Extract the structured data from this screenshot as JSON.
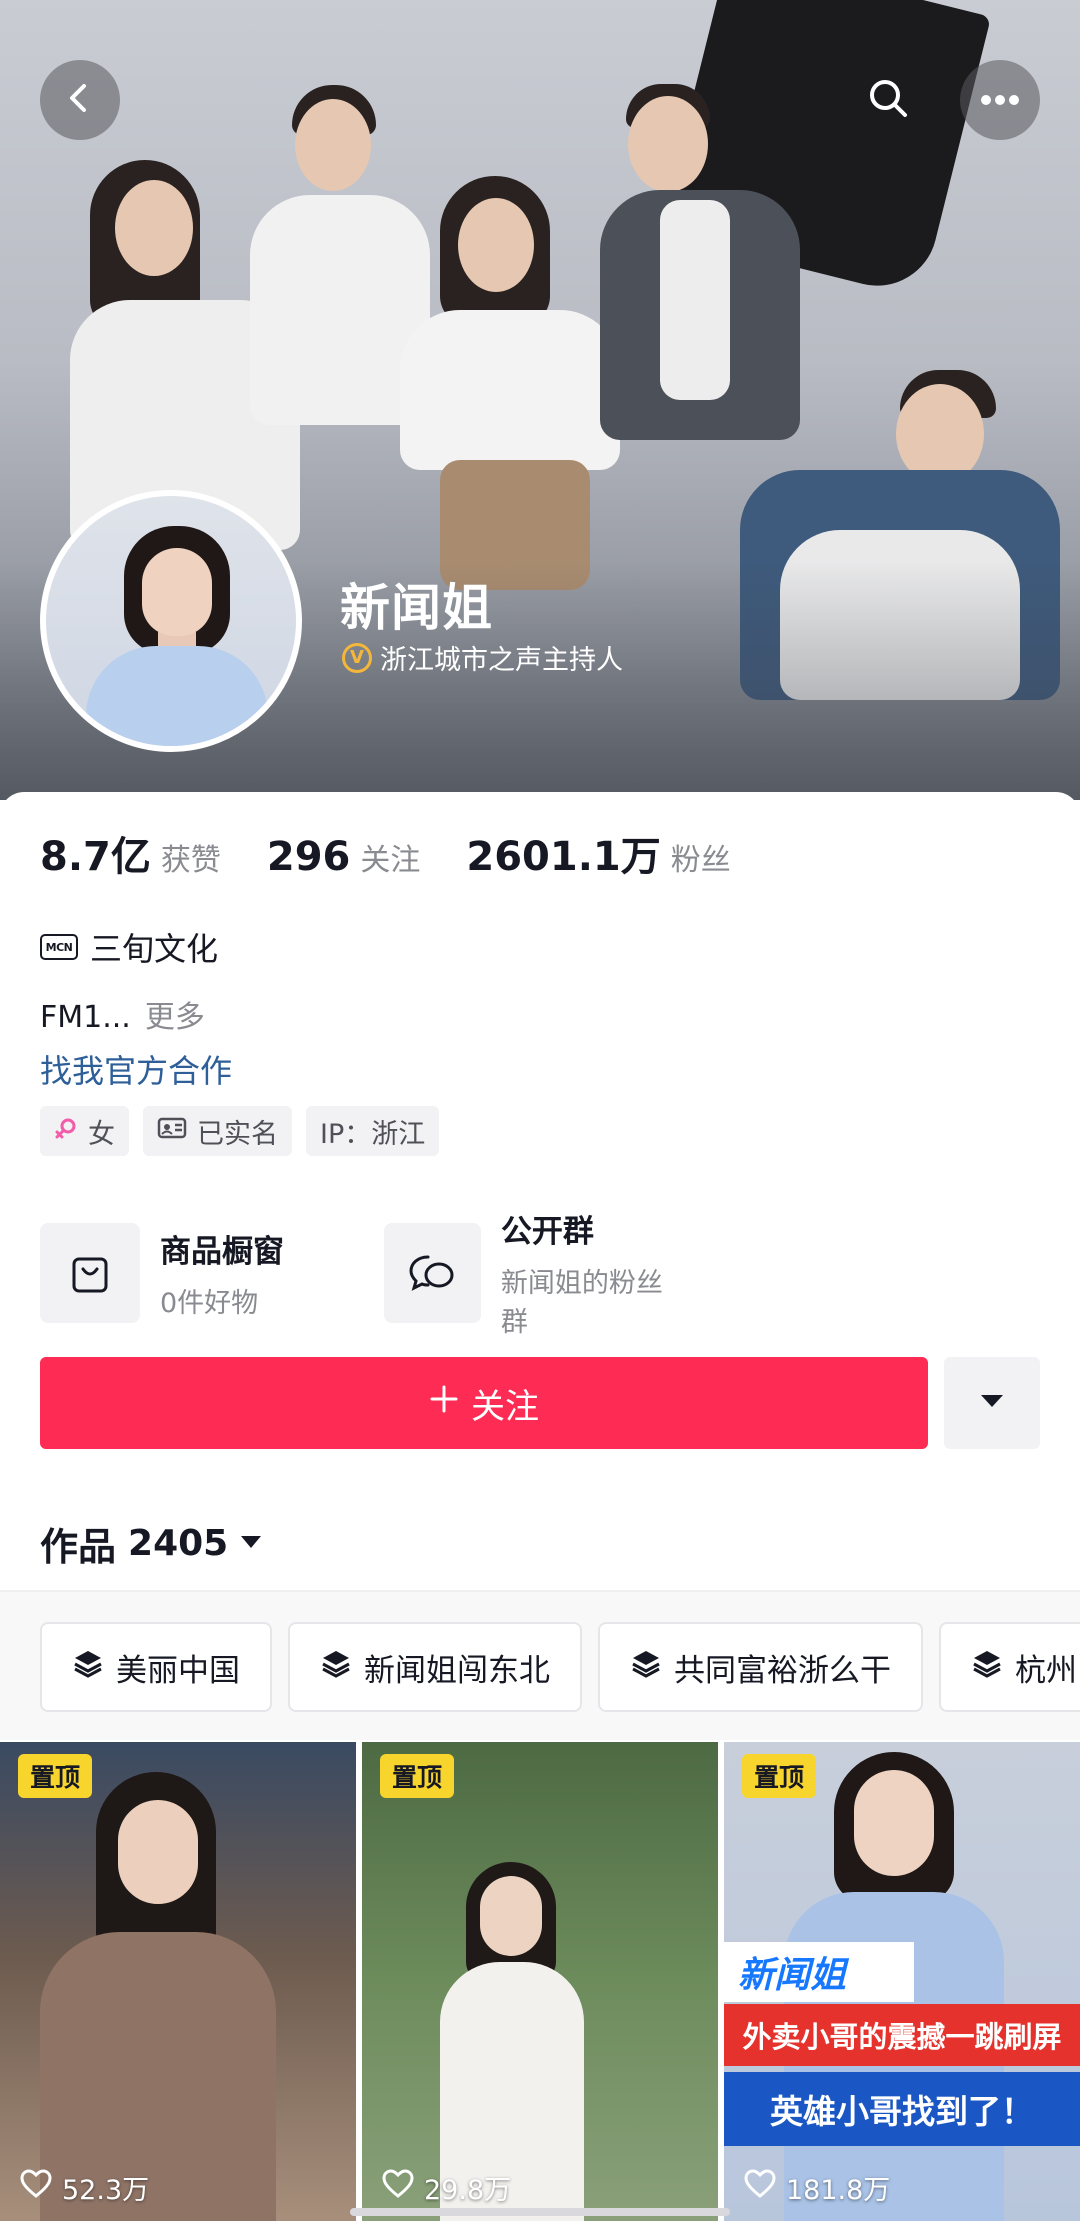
{
  "profile": {
    "name": "新闻姐",
    "verification": "浙江城市之声主持人",
    "verification_badge": "V"
  },
  "stats": [
    {
      "value": "8.7亿",
      "label": "获赞"
    },
    {
      "value": "296",
      "label": "关注"
    },
    {
      "value": "2601.1万",
      "label": "粉丝"
    }
  ],
  "mcn": {
    "badge": "MCN",
    "name": "三旬文化"
  },
  "bio": {
    "text": "FM1...",
    "more": "更多"
  },
  "cooperation_link": "找我官方合作",
  "tags": [
    {
      "icon": "female-icon",
      "label": "女"
    },
    {
      "icon": "id-card-icon",
      "label": "已实名"
    },
    {
      "icon": "",
      "label": "IP：浙江"
    }
  ],
  "services": [
    {
      "icon": "shopping-bag-icon",
      "title": "商品橱窗",
      "subtitle": "0件好物"
    },
    {
      "icon": "chat-group-icon",
      "title": "公开群",
      "subtitle": "新闻姐的粉丝群"
    }
  ],
  "follow_button": {
    "icon": "+",
    "label": "关注"
  },
  "works": {
    "label": "作品",
    "count": "2405"
  },
  "collections": [
    {
      "label": "美丽中国"
    },
    {
      "label": "新闻姐闯东北"
    },
    {
      "label": "共同富裕浙么干"
    },
    {
      "label": "杭州"
    }
  ],
  "videos": [
    {
      "pinned": "置顶",
      "likes": "52.3万"
    },
    {
      "pinned": "置顶",
      "likes": "29.8万"
    },
    {
      "pinned": "置顶",
      "likes": "181.8万",
      "overlay_logo": "新闻姐",
      "overlay_line1": "外卖小哥的震撼一跳刷屏",
      "overlay_line2": "英雄小哥找到了！"
    }
  ],
  "colors": {
    "accent": "#fe2c55",
    "link": "#2e5f98",
    "pinned_badge": "#f8d52d",
    "verified": "#f4b73a"
  }
}
